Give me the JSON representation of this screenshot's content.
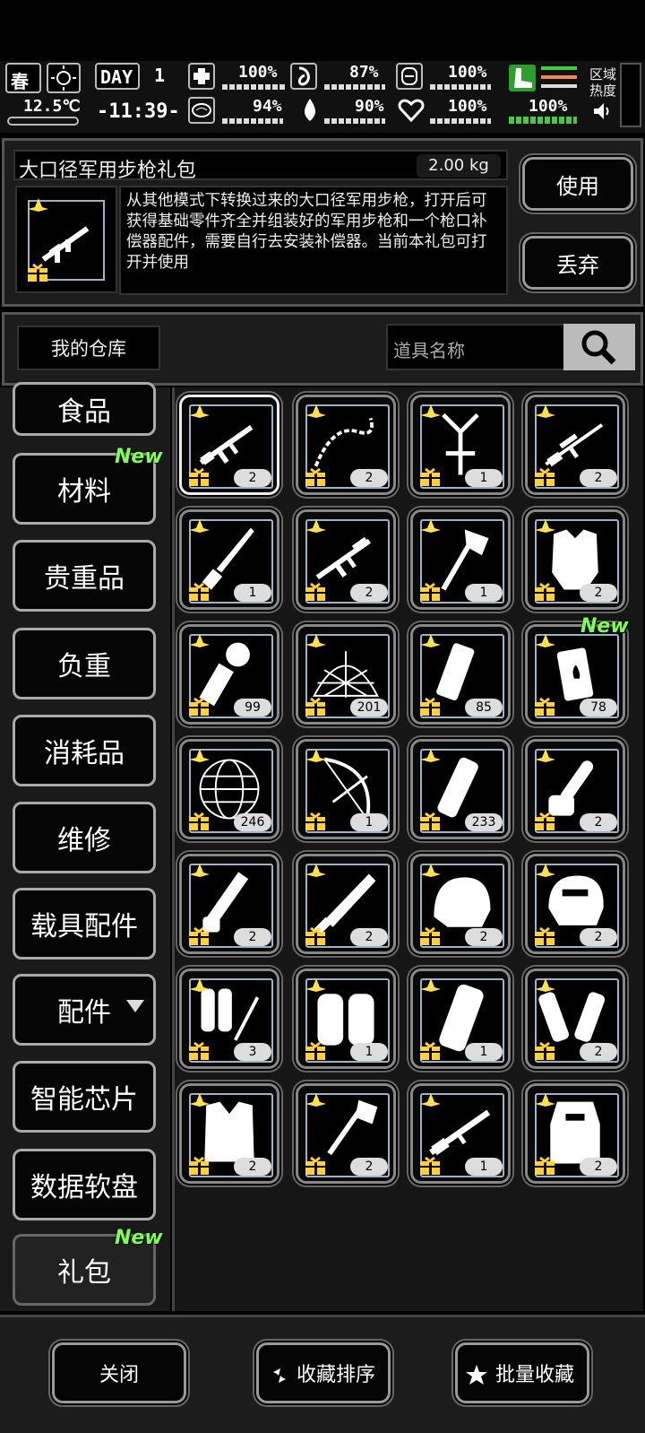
{
  "status": {
    "season": "春",
    "temperature": "12.5℃",
    "day_label": "DAY",
    "day_num": "1",
    "time": "-11:39-",
    "stats": [
      {
        "icon": "medkit-icon",
        "value": "100%"
      },
      {
        "icon": "stomach-icon",
        "value": "87%"
      },
      {
        "icon": "battery-icon",
        "value": "100%"
      },
      {
        "icon": "brain-icon",
        "value": "94%"
      },
      {
        "icon": "water-drop-icon",
        "value": "90%"
      },
      {
        "icon": "heart-icon",
        "value": "100%"
      }
    ],
    "stamina": "100%",
    "region_label": "区域\n热度"
  },
  "detail": {
    "name": "大口径军用步枪礼包",
    "weight": "2.00 kg",
    "description": "从其他模式下转换过来的大口径军用步枪，打开后可获得基础零件齐全并组装好的军用步枪和一个枪口补偿器配件，需要自行去安装补偿器。当前本礼包可打开并使用",
    "use_label": "使用",
    "discard_label": "丢弃"
  },
  "warehouse": {
    "title": "我的仓库",
    "search_placeholder": "道具名称"
  },
  "categories": [
    {
      "label": "食品",
      "new": ""
    },
    {
      "label": "材料",
      "new": "New"
    },
    {
      "label": "贵重品",
      "new": ""
    },
    {
      "label": "负重",
      "new": ""
    },
    {
      "label": "消耗品",
      "new": ""
    },
    {
      "label": "维修",
      "new": ""
    },
    {
      "label": "载具配件",
      "new": ""
    },
    {
      "label": "配件",
      "new": ""
    },
    {
      "label": "智能芯片",
      "new": ""
    },
    {
      "label": "数据软盘",
      "new": ""
    },
    {
      "label": "礼包",
      "new": "New"
    }
  ],
  "items": [
    {
      "icon": "rifle-icon",
      "count": "2",
      "new": ""
    },
    {
      "icon": "chain-icon",
      "count": "2",
      "new": ""
    },
    {
      "icon": "harness-icon",
      "count": "1",
      "new": ""
    },
    {
      "icon": "sniper-rifle-icon",
      "count": "2",
      "new": ""
    },
    {
      "icon": "bayonet-icon",
      "count": "1",
      "new": ""
    },
    {
      "icon": "assault-rifle-icon",
      "count": "2",
      "new": ""
    },
    {
      "icon": "axe-icon",
      "count": "1",
      "new": ""
    },
    {
      "icon": "body-armor-icon",
      "count": "2",
      "new": ""
    },
    {
      "icon": "grenade-icon",
      "count": "99",
      "new": ""
    },
    {
      "icon": "net-icon",
      "count": "201",
      "new": ""
    },
    {
      "icon": "flashbang-icon",
      "count": "85",
      "new": ""
    },
    {
      "icon": "incendiary-icon",
      "count": "78",
      "new": "New"
    },
    {
      "icon": "globe-net-icon",
      "count": "246",
      "new": ""
    },
    {
      "icon": "bow-icon",
      "count": "1",
      "new": ""
    },
    {
      "icon": "smoke-grenade-icon",
      "count": "233",
      "new": ""
    },
    {
      "icon": "chainsaw-icon",
      "count": "2",
      "new": ""
    },
    {
      "icon": "minigun-icon",
      "count": "2",
      "new": ""
    },
    {
      "icon": "machete-icon",
      "count": "2",
      "new": ""
    },
    {
      "icon": "helmet-icon",
      "count": "2",
      "new": ""
    },
    {
      "icon": "tactical-helmet-icon",
      "count": "2",
      "new": ""
    },
    {
      "icon": "flamethrower-icon",
      "count": "3",
      "new": ""
    },
    {
      "icon": "knee-pads-icon",
      "count": "1",
      "new": ""
    },
    {
      "icon": "shin-guard-icon",
      "count": "1",
      "new": ""
    },
    {
      "icon": "arm-guards-icon",
      "count": "2",
      "new": ""
    },
    {
      "icon": "vest-icon",
      "count": "2",
      "new": ""
    },
    {
      "icon": "shovel-icon",
      "count": "2",
      "new": ""
    },
    {
      "icon": "shotgun-icon",
      "count": "1",
      "new": ""
    },
    {
      "icon": "riot-shield-icon",
      "count": "2",
      "new": ""
    }
  ],
  "footer": {
    "close_label": "关闭",
    "sort_label": "收藏排序",
    "batch_label": "批量收藏"
  }
}
